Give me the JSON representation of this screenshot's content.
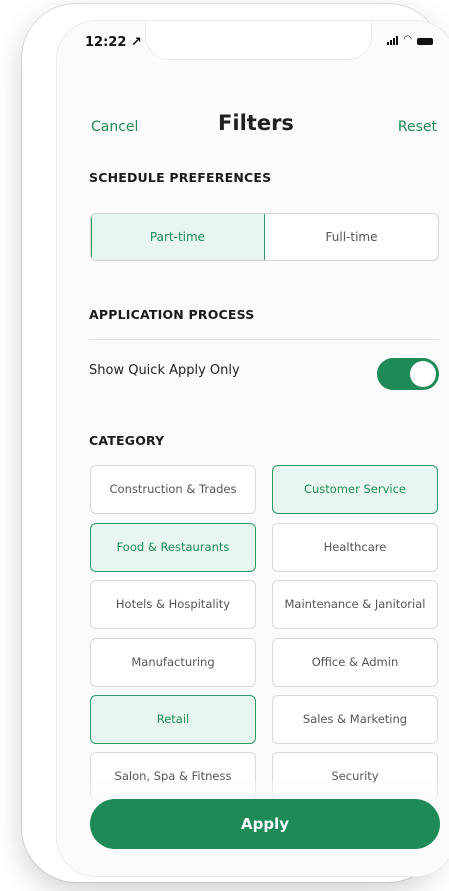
{
  "status": {
    "time": "12:22",
    "arrow": "↗"
  },
  "nav": {
    "cancel": "Cancel",
    "title": "Filters",
    "reset": "Reset"
  },
  "schedule": {
    "title": "SCHEDULE PREFERENCES",
    "options": [
      {
        "label": "Part-time",
        "selected": true
      },
      {
        "label": "Full-time",
        "selected": false
      }
    ]
  },
  "application": {
    "title": "APPLICATION PROCESS",
    "toggle_label": "Show Quick Apply Only",
    "toggle_on": true
  },
  "category": {
    "title": "CATEGORY",
    "items": [
      {
        "label": "Construction & Trades",
        "selected": false
      },
      {
        "label": "Customer Service",
        "selected": true
      },
      {
        "label": "Food & Restaurants",
        "selected": true
      },
      {
        "label": "Healthcare",
        "selected": false
      },
      {
        "label": "Hotels & Hospitality",
        "selected": false
      },
      {
        "label": "Maintenance & Janitorial",
        "selected": false
      },
      {
        "label": "Manufacturing",
        "selected": false
      },
      {
        "label": "Office & Admin",
        "selected": false
      },
      {
        "label": "Retail",
        "selected": true
      },
      {
        "label": "Sales & Marketing",
        "selected": false
      },
      {
        "label": "Salon, Spa & Fitness",
        "selected": false
      },
      {
        "label": "Security",
        "selected": false
      }
    ]
  },
  "apply_label": "Apply",
  "colors": {
    "accent": "#1e8a58",
    "selected_bg": "#e7f6ef"
  }
}
